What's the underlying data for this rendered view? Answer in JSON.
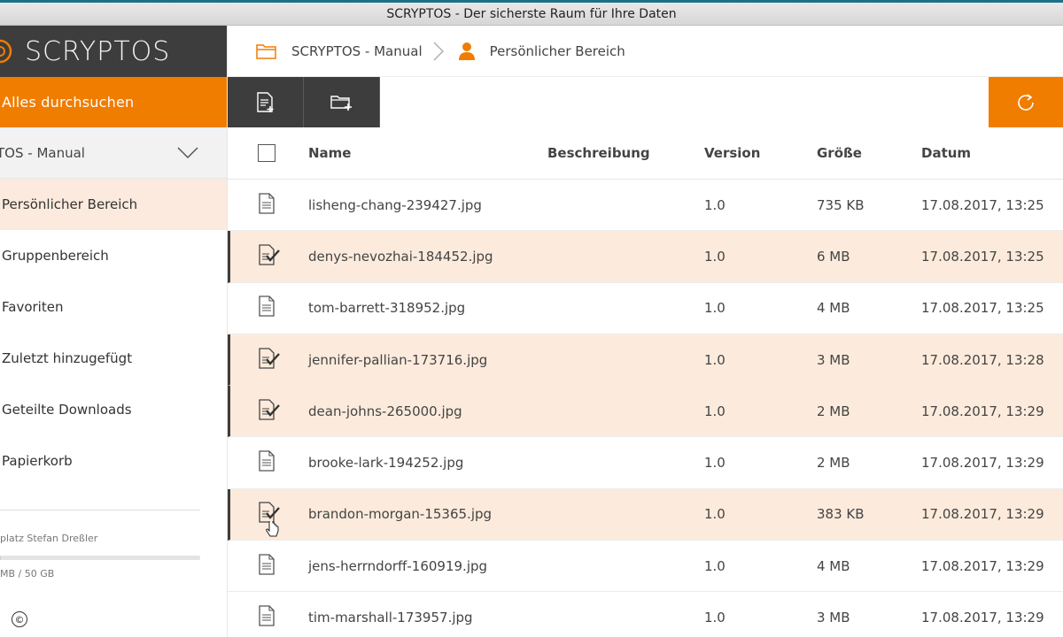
{
  "window": {
    "title": "SCRYPTOS - Der sicherste Raum für Ihre Daten"
  },
  "sidebar": {
    "logo_text": "SCRYPTOS",
    "search_label": "Alles durchsuchen",
    "space_select": "TOS - Manual",
    "items": [
      {
        "label": "Persönlicher Bereich",
        "active": true
      },
      {
        "label": "Gruppenbereich"
      },
      {
        "label": "Favoriten"
      },
      {
        "label": "Zuletzt hinzugefügt"
      },
      {
        "label": "Geteilte Downloads"
      },
      {
        "label": "Papierkorb"
      }
    ],
    "quota_label": "platz Stefan Dreßler",
    "quota_value": "MB / 50 GB",
    "quota_fraction": 0.005,
    "copyright": "©"
  },
  "breadcrumb": {
    "root": "SCRYPTOS - Manual",
    "current": "Persönlicher Bereich"
  },
  "colors": {
    "accent": "#f07d00",
    "dark": "#3d3d3d",
    "selected_row": "#fcebdc"
  },
  "table": {
    "headers": {
      "name": "Name",
      "description": "Beschreibung",
      "version": "Version",
      "size": "Größe",
      "date": "Datum"
    },
    "rows": [
      {
        "name": "lisheng-chang-239427.jpg",
        "version": "1.0",
        "size": "735 KB",
        "date": "17.08.2017, 13:25",
        "selected": false
      },
      {
        "name": "denys-nevozhai-184452.jpg",
        "version": "1.0",
        "size": "6 MB",
        "date": "17.08.2017, 13:25",
        "selected": true
      },
      {
        "name": "tom-barrett-318952.jpg",
        "version": "1.0",
        "size": "4 MB",
        "date": "17.08.2017, 13:25",
        "selected": false
      },
      {
        "name": "jennifer-pallian-173716.jpg",
        "version": "1.0",
        "size": "3 MB",
        "date": "17.08.2017, 13:28",
        "selected": true
      },
      {
        "name": "dean-johns-265000.jpg",
        "version": "1.0",
        "size": "2 MB",
        "date": "17.08.2017, 13:29",
        "selected": true
      },
      {
        "name": "brooke-lark-194252.jpg",
        "version": "1.0",
        "size": "2 MB",
        "date": "17.08.2017, 13:29",
        "selected": false
      },
      {
        "name": "brandon-morgan-15365.jpg",
        "version": "1.0",
        "size": "383 KB",
        "date": "17.08.2017, 13:29",
        "selected": true
      },
      {
        "name": "jens-herrndorff-160919.jpg",
        "version": "1.0",
        "size": "4 MB",
        "date": "17.08.2017, 13:29",
        "selected": false
      },
      {
        "name": "tim-marshall-173957.jpg",
        "version": "1.0",
        "size": "3 MB",
        "date": "17.08.2017, 13:29",
        "selected": false
      }
    ]
  }
}
